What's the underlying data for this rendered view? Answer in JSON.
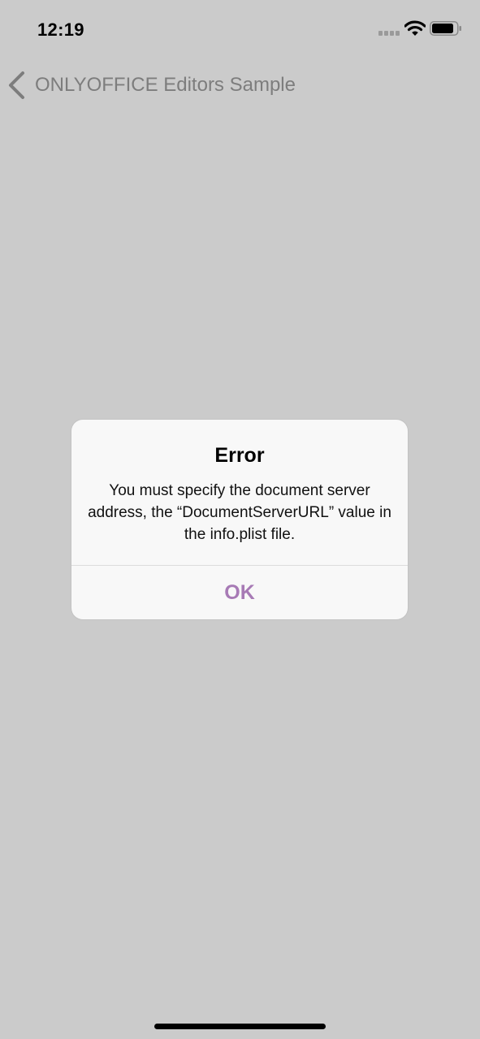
{
  "status_bar": {
    "time": "12:19",
    "icons": [
      "signal-icon",
      "wifi-icon",
      "battery-icon"
    ]
  },
  "nav_bar": {
    "back_icon": "chevron-left-icon",
    "title": "ONLYOFFICE Editors Sample"
  },
  "alert": {
    "title": "Error",
    "message": "You must specify the document server address, the “DocumentServerURL” value in the info.plist file.",
    "ok_label": "OK"
  },
  "colors": {
    "background": "#cbcbcb",
    "alert_background": "#f8f8f8",
    "accent": "#a77ab5",
    "nav_text": "#7d7d7d"
  }
}
